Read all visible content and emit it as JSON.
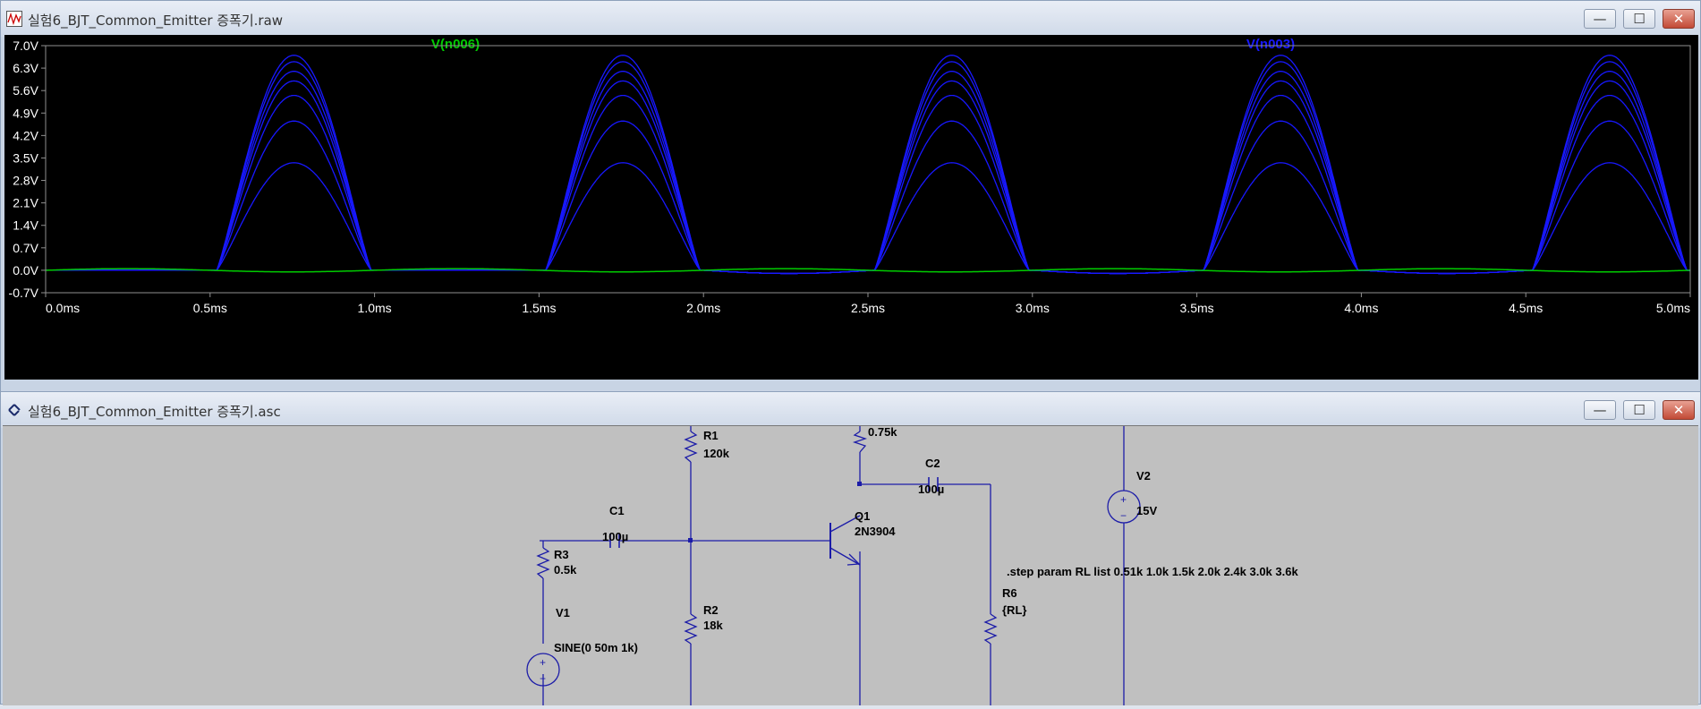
{
  "waveform_window": {
    "title": "실험6_BJT_Common_Emitter 증폭기.raw",
    "icon": "waveform-icon",
    "controls": {
      "minimize": "—",
      "maximize": "☐",
      "close": "✕"
    }
  },
  "schematic_window": {
    "title": "실험6_BJT_Common_Emitter 증폭기.asc",
    "icon": "ltspice-icon",
    "controls": {
      "minimize": "—",
      "maximize": "☐",
      "close": "✕"
    }
  },
  "colors": {
    "green_trace": "#00cc00",
    "blue_trace": "#1818ff",
    "wire": "#1c1ca8",
    "component": "#000080"
  },
  "chart_data": {
    "type": "line",
    "traces": [
      {
        "name": "V(n006)",
        "color": "#00cc00"
      },
      {
        "name": "V(n003)",
        "color": "#1818ff"
      }
    ],
    "x_ticks": [
      "0.0ms",
      "0.5ms",
      "1.0ms",
      "1.5ms",
      "2.0ms",
      "2.5ms",
      "3.0ms",
      "3.5ms",
      "4.0ms",
      "4.5ms",
      "5.0ms"
    ],
    "y_ticks": [
      "7.0V",
      "6.3V",
      "5.6V",
      "4.9V",
      "4.2V",
      "3.5V",
      "2.8V",
      "2.1V",
      "1.4V",
      "0.7V",
      "0.0V",
      "-0.7V"
    ],
    "xlim": [
      0,
      5.0
    ],
    "ylim": [
      -0.7,
      7.0
    ],
    "x_unit": "ms",
    "y_unit": "V",
    "pulse_period_ms": 1.0,
    "pulse_start_ms": 0.52,
    "pulse_end_ms": 0.99,
    "step_peaks_v": [
      3.35,
      4.65,
      5.45,
      5.9,
      6.2,
      6.5,
      6.7
    ],
    "green_amplitude_v": 0.05,
    "blue_negative_dip_v": -0.1,
    "grid": false
  },
  "schematic": {
    "components": {
      "r1": {
        "name": "R1",
        "value": "120k"
      },
      "r2": {
        "name": "R2",
        "value": "18k"
      },
      "r3": {
        "name": "R3",
        "value": "0.5k"
      },
      "rc": {
        "value": "0.75k"
      },
      "r6": {
        "name": "R6",
        "value": "{RL}"
      },
      "c1": {
        "name": "C1",
        "value": "100µ"
      },
      "c2": {
        "name": "C2",
        "value": "100µ"
      },
      "q1": {
        "name": "Q1",
        "value": "2N3904"
      },
      "v1": {
        "name": "V1",
        "value": "SINE(0 50m 1k)"
      },
      "v2": {
        "name": "V2",
        "value": "15V"
      }
    },
    "directive": ".step param RL list 0.51k 1.0k 1.5k 2.0k 2.4k 3.0k 3.6k"
  }
}
